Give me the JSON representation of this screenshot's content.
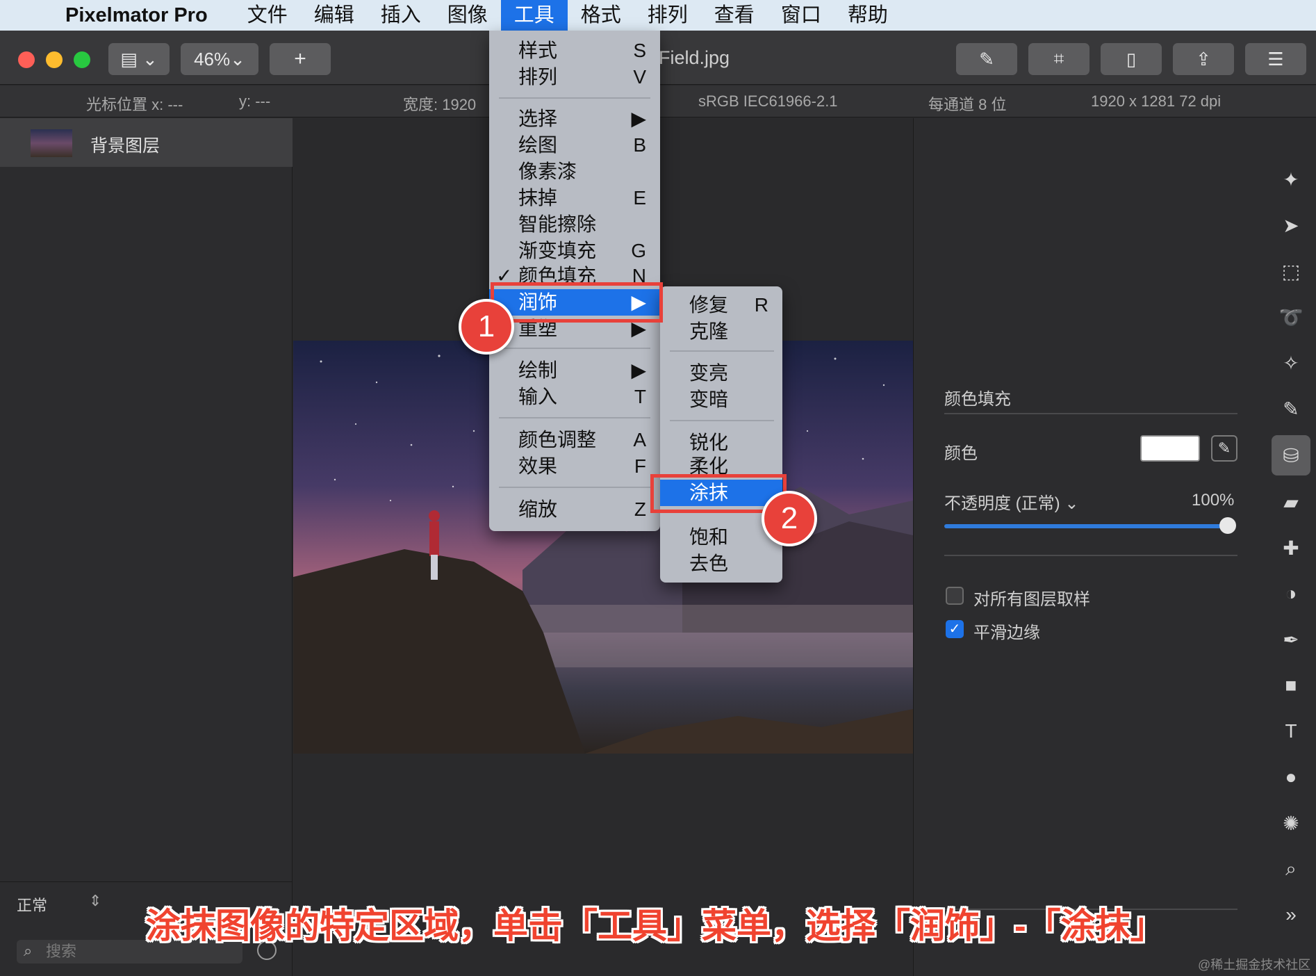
{
  "menubar": {
    "app_name": "Pixelmator Pro",
    "items": [
      "文件",
      "编辑",
      "插入",
      "图像",
      "工具",
      "格式",
      "排列",
      "查看",
      "窗口",
      "帮助"
    ],
    "active": "工具"
  },
  "toolbar": {
    "zoom": "46%",
    "add": "+",
    "doc_title": "Field.jpg",
    "traffic_colors": [
      "#fe5f57",
      "#febc2e",
      "#28c840"
    ]
  },
  "infobar": {
    "cursor_x": "光标位置 x:  ---",
    "cursor_y": "y:  ---",
    "width": "宽度:  1920",
    "color_profile": "sRGB IEC61966-2.1",
    "bits": "每通道 8 位",
    "size": "1920 x 1281 72 dpi"
  },
  "layers": {
    "items": [
      {
        "name": "背景图层"
      }
    ],
    "blend_mode": "正常",
    "search_placeholder": "搜索"
  },
  "tools_menu": {
    "items": [
      {
        "label": "样式",
        "shortcut": "S"
      },
      {
        "label": "排列",
        "shortcut": "V"
      },
      {
        "label": "选择",
        "shortcut": "▶"
      },
      {
        "label": "绘图",
        "shortcut": "B"
      },
      {
        "label": "像素漆",
        "shortcut": ""
      },
      {
        "label": "抹掉",
        "shortcut": "E"
      },
      {
        "label": "智能擦除",
        "shortcut": ""
      },
      {
        "label": "渐变填充",
        "shortcut": "G"
      },
      {
        "label": "颜色填充",
        "shortcut": "N",
        "checked": "✓"
      },
      {
        "label": "润饰",
        "shortcut": "▶"
      },
      {
        "label": "重塑",
        "shortcut": "▶"
      },
      {
        "label": "绘制",
        "shortcut": "▶"
      },
      {
        "label": "输入",
        "shortcut": "T"
      },
      {
        "label": "颜色调整",
        "shortcut": "A"
      },
      {
        "label": "效果",
        "shortcut": "F"
      },
      {
        "label": "缩放",
        "shortcut": "Z"
      }
    ]
  },
  "retouch_menu": {
    "items": [
      {
        "label": "修复",
        "shortcut": "R"
      },
      {
        "label": "克隆",
        "shortcut": ""
      },
      {
        "label": "变亮",
        "shortcut": ""
      },
      {
        "label": "变暗",
        "shortcut": ""
      },
      {
        "label": "锐化",
        "shortcut": ""
      },
      {
        "label": "柔化",
        "shortcut": ""
      },
      {
        "label": "涂抹",
        "shortcut": ""
      },
      {
        "label": "饱和",
        "shortcut": ""
      },
      {
        "label": "去色",
        "shortcut": ""
      }
    ]
  },
  "tool_options": {
    "title": "颜色填充",
    "color_label": "颜色",
    "color_value": "#ffffff",
    "opacity_label": "不透明度 (正常) ⌄",
    "opacity_value": "100%",
    "opacity": 1.0,
    "sample_all_layers": "对所有图层取样",
    "sample_all_layers_checked": false,
    "smooth_edges": "平滑边缘",
    "smooth_edges_checked": true
  },
  "tool_strip": [
    "wand-icon",
    "arrow-icon",
    "rect-select-icon",
    "lasso-icon",
    "magic-select-icon",
    "brush-icon",
    "paint-bucket-icon",
    "eraser-icon",
    "bandage-icon",
    "distort-icon",
    "pen-icon",
    "shape-icon",
    "text-icon",
    "color-adjust-icon",
    "effects-icon",
    "zoom-icon",
    "more-icon"
  ],
  "annotations": {
    "badge1": "1",
    "badge2": "2",
    "caption": "涂抹图像的特定区域，单击「工具」菜单，选择「润饰」-「涂抹」",
    "accent": "#e8413a"
  },
  "watermark": "@稀土掘金技术社区"
}
